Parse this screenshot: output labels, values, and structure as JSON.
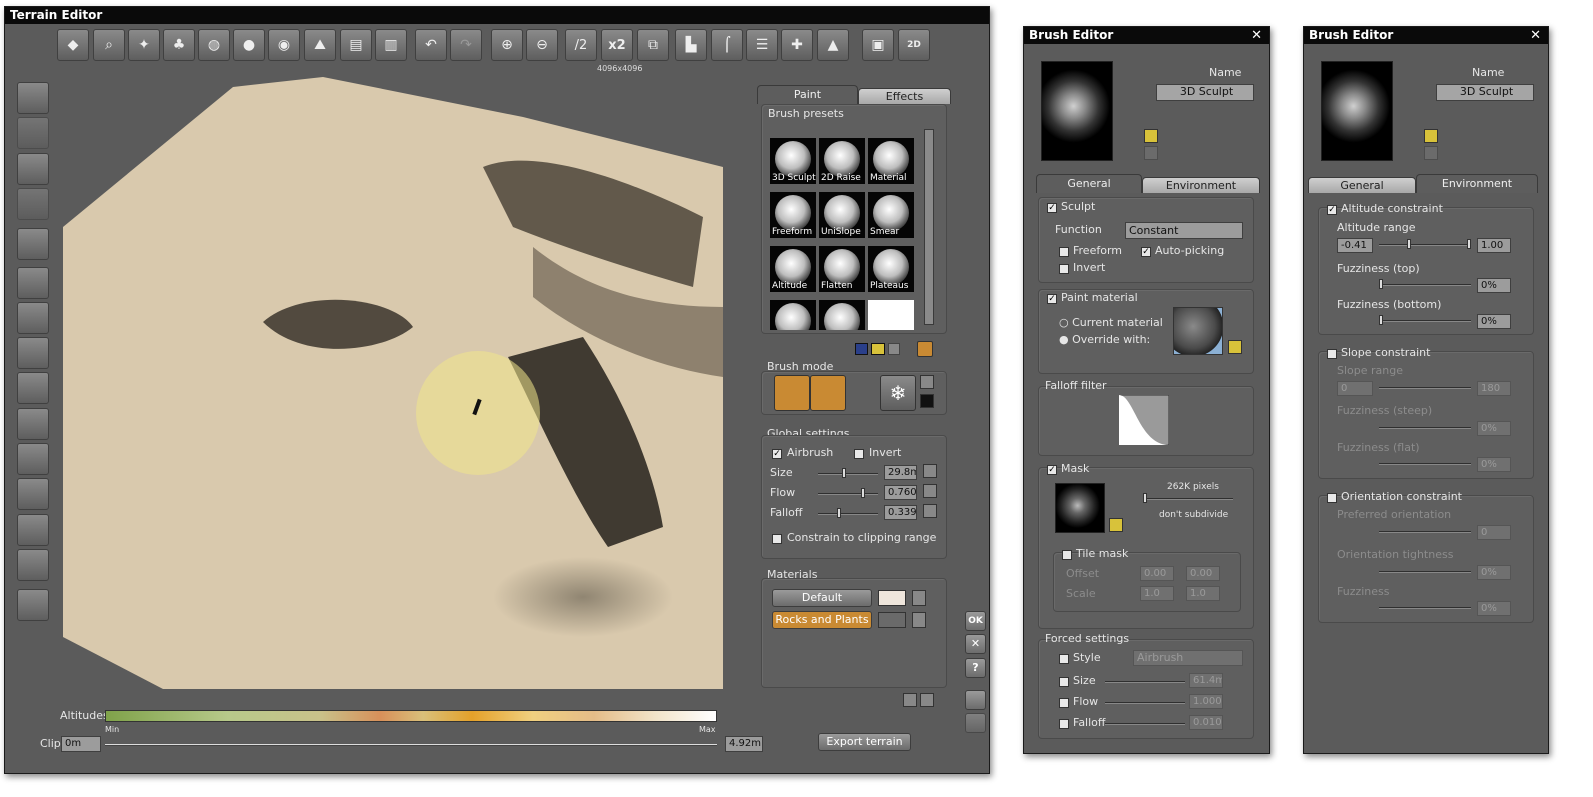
{
  "terrain": {
    "title": "Terrain Editor",
    "resolution": "4096x4096",
    "zoom_half": "/2",
    "zoom_double": "x2",
    "tabs": [
      "Paint",
      "Effects"
    ],
    "brush_presets_label": "Brush presets",
    "presets": [
      "3D Sculpt",
      "2D Raise",
      "Material",
      "Freeform",
      "UniSlope",
      "Smear",
      "Altitude",
      "Flatten",
      "Plateaus",
      "",
      "",
      ""
    ],
    "brush_mode_label": "Brush mode",
    "global_settings_label": "Global settings",
    "airbrush_label": "Airbrush",
    "invert_label": "Invert",
    "size_label": "Size",
    "size_value": "29.8m",
    "size_level": 0.42,
    "flow_label": "Flow",
    "flow_value": "0.760",
    "flow_level": 0.76,
    "falloff_label": "Falloff",
    "falloff_value": "0.339",
    "falloff_level": 0.34,
    "constrain_label": "Constrain to clipping range",
    "materials_label": "Materials",
    "material_default": "Default",
    "material_rocks": "Rocks and Plants",
    "ok_label": "OK",
    "help_label": "?",
    "altitudes_label": "Altitudes",
    "min_label": "Min",
    "max_label": "Max",
    "clip_label": "Clip",
    "clip_min": "0m",
    "clip_max": "4.92m",
    "export_label": "Export terrain",
    "terrain_color": "#d9c9ad",
    "accent_orange": "#c98a33"
  },
  "brush1": {
    "title": "Brush Editor",
    "name_label": "Name",
    "name_value": "3D Sculpt",
    "tabs": [
      "General",
      "Environment"
    ],
    "sculpt_label": "Sculpt",
    "function_label": "Function",
    "function_value": "Constant",
    "freeform_label": "Freeform",
    "autopicking_label": "Auto-picking",
    "invert_label": "Invert",
    "paint_material_label": "Paint material",
    "current_material_label": "Current material",
    "override_label": "Override with:",
    "falloff_filter_label": "Falloff filter",
    "mask_label": "Mask",
    "mask_pixels": "262K pixels",
    "mask_subdiv": "don't subdivide",
    "tile_mask_label": "Tile mask",
    "offset_label": "Offset",
    "offset_x": "0.00",
    "offset_y": "0.00",
    "scale_label": "Scale",
    "scale_x": "1.0",
    "scale_y": "1.0",
    "forced_label": "Forced settings",
    "style_label": "Style",
    "style_value": "Airbrush",
    "size_label": "Size",
    "size_value": "61.4m",
    "flow_label": "Flow",
    "flow_value": "1.000",
    "falloff_label": "Falloff",
    "falloff_value": "0.010"
  },
  "brush2": {
    "title": "Brush Editor",
    "name_label": "Name",
    "name_value": "3D Sculpt",
    "tabs": [
      "General",
      "Environment"
    ],
    "altitude_constraint_label": "Altitude constraint",
    "altitude_range_label": "Altitude range",
    "alt_min": "-0.41",
    "alt_max": "1.00",
    "fuzz_top_label": "Fuzziness (top)",
    "fuzz_top_value": "0%",
    "fuzz_bottom_label": "Fuzziness (bottom)",
    "fuzz_bottom_value": "0%",
    "slope_constraint_label": "Slope constraint",
    "slope_range_label": "Slope range",
    "slope_min": "0",
    "slope_max": "180",
    "fuzz_steep_label": "Fuzziness (steep)",
    "fuzz_steep_value": "0%",
    "fuzz_flat_label": "Fuzziness (flat)",
    "fuzz_flat_value": "0%",
    "orientation_constraint_label": "Orientation constraint",
    "pref_orientation_label": "Preferred orientation",
    "pref_orientation_value": "0",
    "orient_tightness_label": "Orientation tightness",
    "orient_tightness_value": "0%",
    "fuzziness_label": "Fuzziness",
    "fuzziness_value": "0%"
  }
}
